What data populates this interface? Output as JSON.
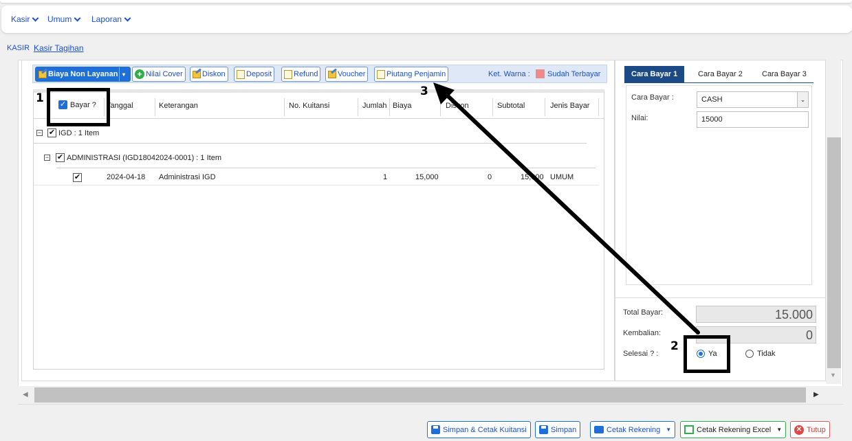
{
  "menu": [
    {
      "label": "Kasir"
    },
    {
      "label": "Umum"
    },
    {
      "label": "Laporan"
    }
  ],
  "breadcrumb": {
    "root": "KASIR",
    "current": "Kasir Tagihan"
  },
  "toolbar": {
    "biaya_non_layanan": "Biaya Non Layanan",
    "nilai_cover": "Nilai Cover",
    "diskon": "Diskon",
    "deposit": "Deposit",
    "refund": "Refund",
    "voucher": "Voucher",
    "piutang_penjamin": "Piutang Penjamin",
    "ket_warna": "Ket. Warna :",
    "sudah_terbayar": "Sudah Terbayar",
    "legend_color": "#f08a8a"
  },
  "grid": {
    "columns": [
      "Bayar ?",
      "Tanggal",
      "Keterangan",
      "No. Kuitansi",
      "Jumlah",
      "Biaya",
      "Diskon",
      "Subtotal",
      "Jenis Bayar"
    ],
    "group1": "IGD : 1 Item",
    "group2": "ADMINISTRASI (IGD18042024-0001) : 1 Item",
    "row": {
      "tanggal": "2024-04-18",
      "keterangan": "Administrasi IGD",
      "jumlah": "1",
      "biaya": "15,000",
      "diskon": "0",
      "subtotal": "15,000",
      "jenis_bayar": "UMUM"
    }
  },
  "payment": {
    "tabs": [
      "Cara Bayar 1",
      "Cara Bayar 2",
      "Cara Bayar 3"
    ],
    "cara_bayar_label": "Cara Bayar :",
    "cara_bayar_value": "CASH",
    "nilai_label": "Nilai:",
    "nilai_value": "15000",
    "total_label": "Total Bayar:",
    "total_value": "15.000",
    "kembalian_label": "Kembalian:",
    "kembalian_value": "0",
    "selesai_label": "Selesai ? :",
    "ya": "Ya",
    "tidak": "Tidak"
  },
  "footer": {
    "simpan_cetak": "Simpan & Cetak Kuitansi",
    "simpan": "Simpan",
    "cetak_rekening": "Cetak Rekening",
    "cetak_excel": "Cetak Rekening Excel",
    "tutup": "Tutup"
  },
  "annotations": {
    "n1": "1",
    "n2": "2",
    "n3": "3"
  }
}
